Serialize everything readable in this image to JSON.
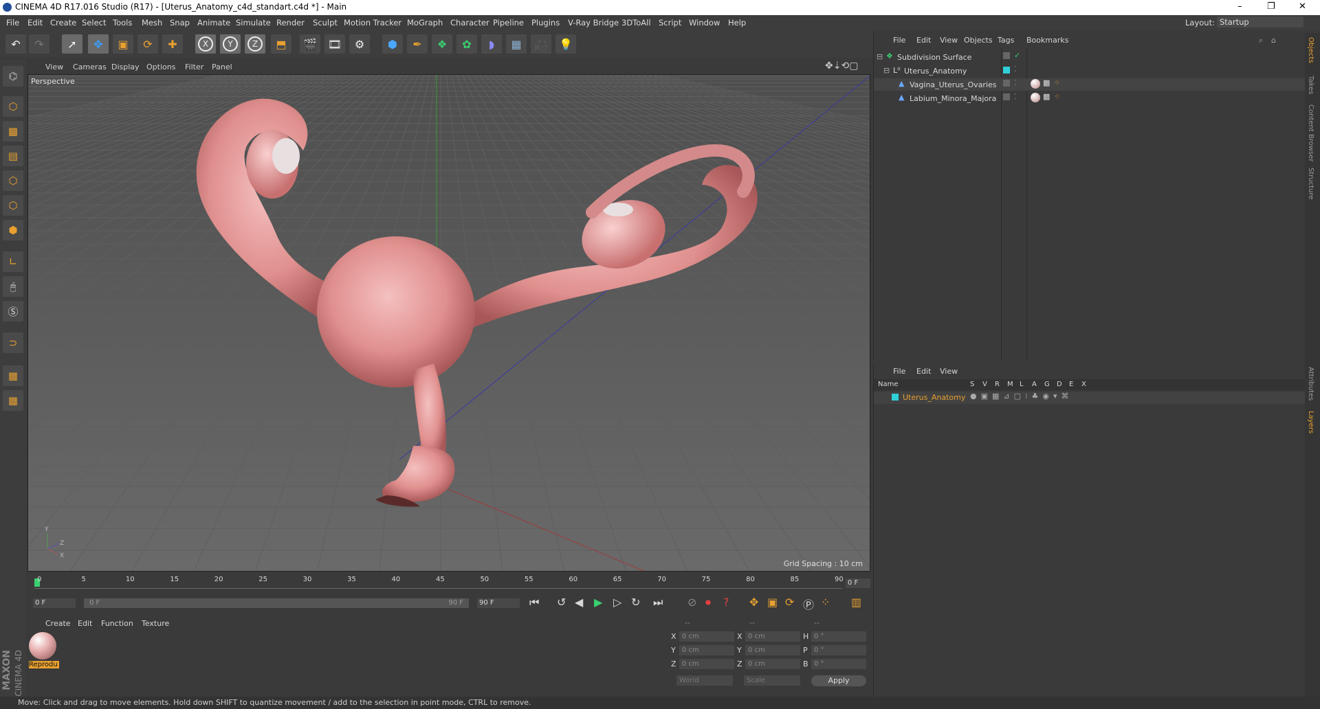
{
  "window": {
    "title": "CINEMA 4D R17.016 Studio (R17) - [Uterus_Anatomy_c4d_standart.c4d *] - Main",
    "minimize": "–",
    "maximize": "❐",
    "close": "✕"
  },
  "menubar": [
    "File",
    "Edit",
    "Create",
    "Select",
    "Tools",
    "Mesh",
    "Snap",
    "Animate",
    "Simulate",
    "Render",
    "Sculpt",
    "Motion Tracker",
    "MoGraph",
    "Character",
    "Pipeline",
    "Plugins",
    "V-Ray Bridge",
    "3DToAll",
    "Script",
    "Window",
    "Help"
  ],
  "layout": {
    "label": "Layout:",
    "value": "Startup"
  },
  "toolbar": {
    "icons": [
      "undo-icon",
      "redo-icon",
      "select-icon",
      "move-icon",
      "scale-icon",
      "rotate-icon",
      "transform-icon",
      "x-axis",
      "y-axis",
      "z-axis",
      "coord-system-icon",
      "render-view-icon",
      "render-picture-icon",
      "render-settings-icon",
      "cube-icon",
      "pen-icon",
      "subdivision-icon",
      "cloner-icon",
      "deformer-icon",
      "floor-icon",
      "camera-icon",
      "light-icon"
    ],
    "x_label": "X",
    "y_label": "Y",
    "z_label": "Z"
  },
  "viewport": {
    "menu": [
      "View",
      "Cameras",
      "Display",
      "Options",
      "Filter",
      "Panel"
    ],
    "camera_label": "Perspective",
    "grid_spacing": "Grid Spacing : 10 cm",
    "axis_y": "Y",
    "axis_z": "Z",
    "axis_x": "X"
  },
  "timeline": {
    "ticks": [
      "0",
      "5",
      "10",
      "15",
      "20",
      "25",
      "30",
      "35",
      "40",
      "45",
      "50",
      "55",
      "60",
      "65",
      "70",
      "75",
      "80",
      "85",
      "90"
    ],
    "current_frame": "0 F",
    "start_field": "0 F",
    "range_start": "0 F",
    "range_end": "90 F",
    "end_field": "90 F"
  },
  "materials": {
    "menu": [
      "Create",
      "Edit",
      "Function",
      "Texture"
    ],
    "items": [
      {
        "name": "Reprodu"
      }
    ]
  },
  "coords": {
    "headers": [
      "--",
      "--",
      "--"
    ],
    "rows": [
      {
        "a": "X",
        "av": "0 cm",
        "b": "X",
        "bv": "0 cm",
        "c": "H",
        "cv": "0 °"
      },
      {
        "a": "Y",
        "av": "0 cm",
        "b": "Y",
        "bv": "0 cm",
        "c": "P",
        "cv": "0 °"
      },
      {
        "a": "Z",
        "av": "0 cm",
        "b": "Z",
        "bv": "0 cm",
        "c": "B",
        "cv": "0 °"
      }
    ],
    "world": "World",
    "scale": "Scale",
    "apply": "Apply"
  },
  "objects_panel": {
    "menu": [
      "File",
      "Edit",
      "View",
      "Objects",
      "Tags",
      "Bookmarks"
    ],
    "items": [
      {
        "name": "Subdivision Surface",
        "indent": 0
      },
      {
        "name": "Uterus_Anatomy",
        "indent": 1
      },
      {
        "name": "Vagina_Uterus_Ovaries",
        "indent": 2
      },
      {
        "name": "Labium_Minora_Majora",
        "indent": 2
      }
    ]
  },
  "layers_panel": {
    "menu": [
      "File",
      "Edit",
      "View"
    ],
    "col_name": "Name",
    "cols": [
      "S",
      "V",
      "R",
      "M",
      "L",
      "A",
      "G",
      "D",
      "E",
      "X"
    ],
    "items": [
      {
        "name": "Uterus_Anatomy",
        "color": "#2fd0d8"
      }
    ]
  },
  "right_tabs": [
    "Objects",
    "Takes",
    "Content Browser",
    "Structure",
    "Attributes",
    "Layers"
  ],
  "status": "Move: Click and drag to move elements. Hold down SHIFT to quantize movement / add to the selection in point mode, CTRL to remove.",
  "brand": {
    "maxon": "MAXON",
    "c4d": "CINEMA 4D"
  },
  "colors": {
    "accent": "#e8a030",
    "layer": "#2fd0d8",
    "active_object": "#e8a030"
  }
}
